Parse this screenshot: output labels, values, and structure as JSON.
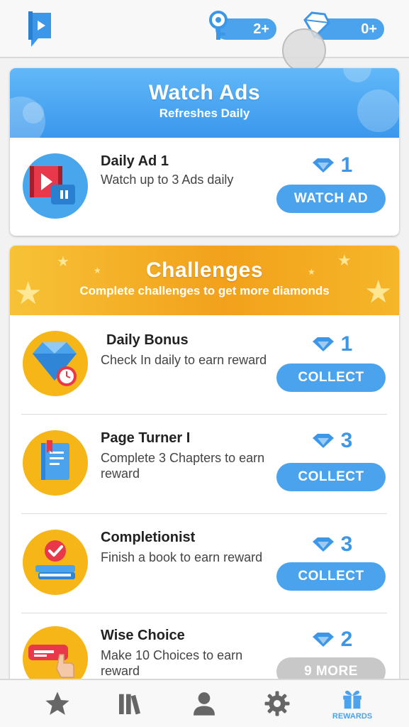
{
  "header": {
    "keys_count": "2+",
    "diamonds_count": "0+"
  },
  "watch_ads": {
    "title": "Watch Ads",
    "subtitle": "Refreshes Daily",
    "items": [
      {
        "title": "Daily Ad 1",
        "description": "Watch up to 3 Ads daily",
        "reward": "1",
        "button": "WATCH AD"
      }
    ]
  },
  "challenges": {
    "title": "Challenges",
    "subtitle": "Complete challenges to get more diamonds",
    "items": [
      {
        "title": "Daily Bonus",
        "description": "Check In daily to earn reward",
        "reward": "1",
        "button": "COLLECT"
      },
      {
        "title": "Page Turner I",
        "description": "Complete 3 Chapters to earn reward",
        "reward": "3",
        "button": "COLLECT"
      },
      {
        "title": "Completionist",
        "description": "Finish a book to earn reward",
        "reward": "3",
        "button": "COLLECT"
      },
      {
        "title": "Wise Choice",
        "description": "Make 10 Choices to earn reward",
        "reward": "2",
        "button": "9 MORE"
      }
    ]
  },
  "bottom_nav": {
    "items": [
      {
        "icon": "star-icon",
        "label": ""
      },
      {
        "icon": "library-icon",
        "label": ""
      },
      {
        "icon": "profile-icon",
        "label": ""
      },
      {
        "icon": "gear-icon",
        "label": ""
      },
      {
        "icon": "gift-icon",
        "label": "REWARDS"
      }
    ]
  },
  "colors": {
    "accent_blue": "#4aa3ec",
    "banner_gold": "#f2a11b",
    "disabled_gray": "#c8c8c8"
  }
}
